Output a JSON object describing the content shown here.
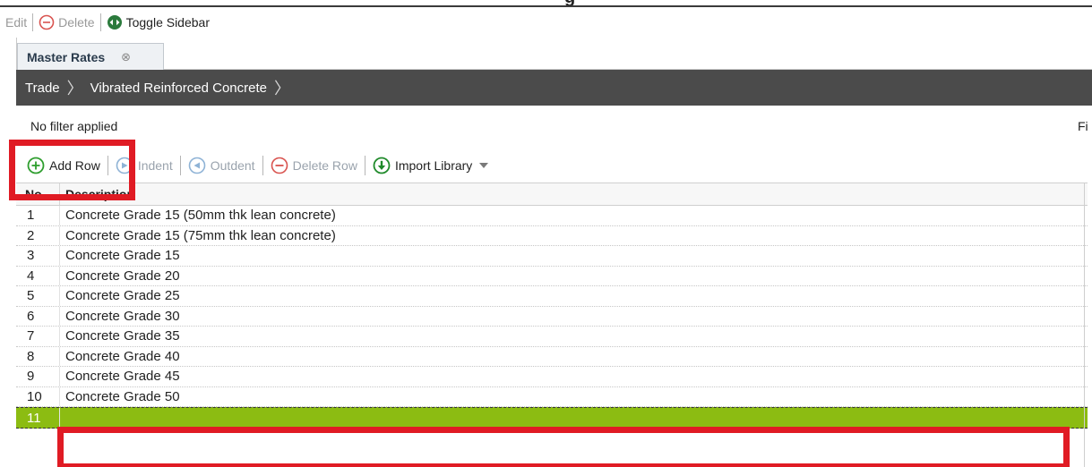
{
  "top_toolbar": {
    "edit_label": "Edit",
    "delete_label": "Delete",
    "toggle_sidebar_label": "Toggle Sidebar"
  },
  "tabs": [
    {
      "label": "Master Rates",
      "close_glyph": "⊗"
    }
  ],
  "breadcrumb": {
    "items": [
      "Trade",
      "Vibrated Reinforced Concrete"
    ]
  },
  "filter": {
    "status": "No filter applied",
    "right_cutoff_text": "Fi"
  },
  "grid_toolbar": {
    "add_row_label": "Add Row",
    "indent_label": "Indent",
    "outdent_label": "Outdent",
    "delete_row_label": "Delete Row",
    "import_library_label": "Import Library"
  },
  "grid": {
    "columns": {
      "no": "No",
      "description": "Description"
    },
    "rows": [
      {
        "no": "1",
        "description": "Concrete Grade 15 (50mm thk lean concrete)"
      },
      {
        "no": "2",
        "description": "Concrete Grade 15 (75mm thk lean concrete)"
      },
      {
        "no": "3",
        "description": "Concrete Grade 15"
      },
      {
        "no": "4",
        "description": "Concrete Grade 20"
      },
      {
        "no": "5",
        "description": "Concrete Grade 25"
      },
      {
        "no": "6",
        "description": "Concrete Grade 30"
      },
      {
        "no": "7",
        "description": "Concrete Grade 35"
      },
      {
        "no": "8",
        "description": "Concrete Grade 40"
      },
      {
        "no": "9",
        "description": "Concrete Grade 45"
      },
      {
        "no": "10",
        "description": "Concrete Grade 50"
      }
    ],
    "new_row": {
      "no": "11",
      "description": ""
    }
  },
  "colors": {
    "selected_row": "#8cbc12",
    "breadcrumb_bg": "#4b4b4b",
    "highlight": "#e01b24",
    "add_icon": "#2e9e2e",
    "import_icon": "#1f8a2a",
    "delete_icon": "#d9534f",
    "toggle_icon": "#2b7a3c"
  },
  "icons": {
    "delete": "minus-circle-icon",
    "toggle_sidebar": "double-arrow-circle-icon",
    "add_row": "plus-circle-icon",
    "indent": "arrow-right-circle-icon",
    "outdent": "arrow-left-circle-icon",
    "delete_row": "minus-circle-icon",
    "import_library": "arrow-down-circle-icon",
    "dropdown": "caret-down-icon"
  }
}
